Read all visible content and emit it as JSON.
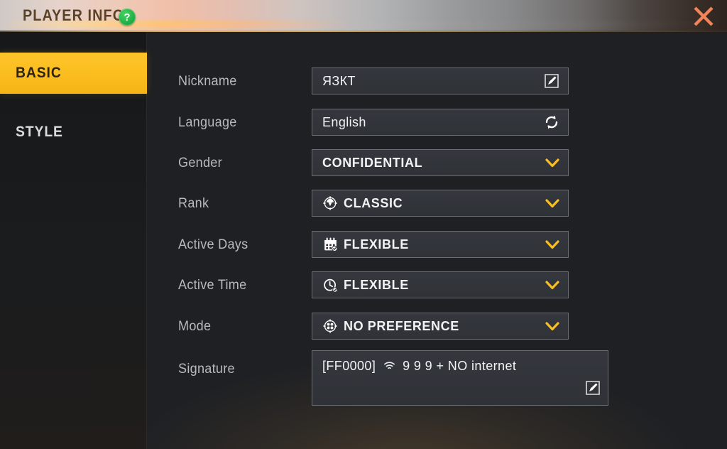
{
  "window": {
    "title": "PLAYER INFO",
    "help_badge": "?",
    "close_icon": "close-x-icon"
  },
  "theme": {
    "accent": "#fbbe1f",
    "close": "#f2845a",
    "badge_green": "#24b346",
    "field_bg": "#32353b",
    "field_border": "#6a6d73",
    "panel_bg": "#1e2023",
    "label_color": "#b8babd"
  },
  "sidebar": {
    "items": [
      {
        "label": "BASIC",
        "active": true
      },
      {
        "label": "STYLE",
        "active": false
      }
    ]
  },
  "form": {
    "rows": [
      {
        "label": "Nickname",
        "value": "ЯЗКТ",
        "icon": null,
        "control": "text",
        "end_icon": "pencil-edit-icon"
      },
      {
        "label": "Language",
        "value": "English",
        "icon": null,
        "control": "refresh",
        "end_icon": "refresh-sync-icon"
      },
      {
        "label": "Gender",
        "value": "CONFIDENTIAL",
        "icon": null,
        "control": "dropdown",
        "end_icon": "chevron-down-icon"
      },
      {
        "label": "Rank",
        "value": "CLASSIC",
        "icon": "parachute-rank-icon",
        "control": "dropdown",
        "end_icon": "chevron-down-icon"
      },
      {
        "label": "Active Days",
        "value": "FLEXIBLE",
        "icon": "calendar-icon",
        "control": "dropdown",
        "end_icon": "chevron-down-icon"
      },
      {
        "label": "Active Time",
        "value": "FLEXIBLE",
        "icon": "clock-icon",
        "control": "dropdown",
        "end_icon": "chevron-down-icon"
      },
      {
        "label": "Mode",
        "value": "NO PREFERENCE",
        "icon": "mode-target-icon",
        "control": "dropdown",
        "end_icon": "chevron-down-icon"
      },
      {
        "label": "Signature",
        "value": "[FF0000] 📶 9 9 9 + NO internet",
        "icon": null,
        "control": "textarea",
        "end_icon": "pencil-edit-icon"
      }
    ],
    "signature_text_prefix": "[FF0000]",
    "signature_text_suffix": "9 9 9 + NO internet"
  }
}
